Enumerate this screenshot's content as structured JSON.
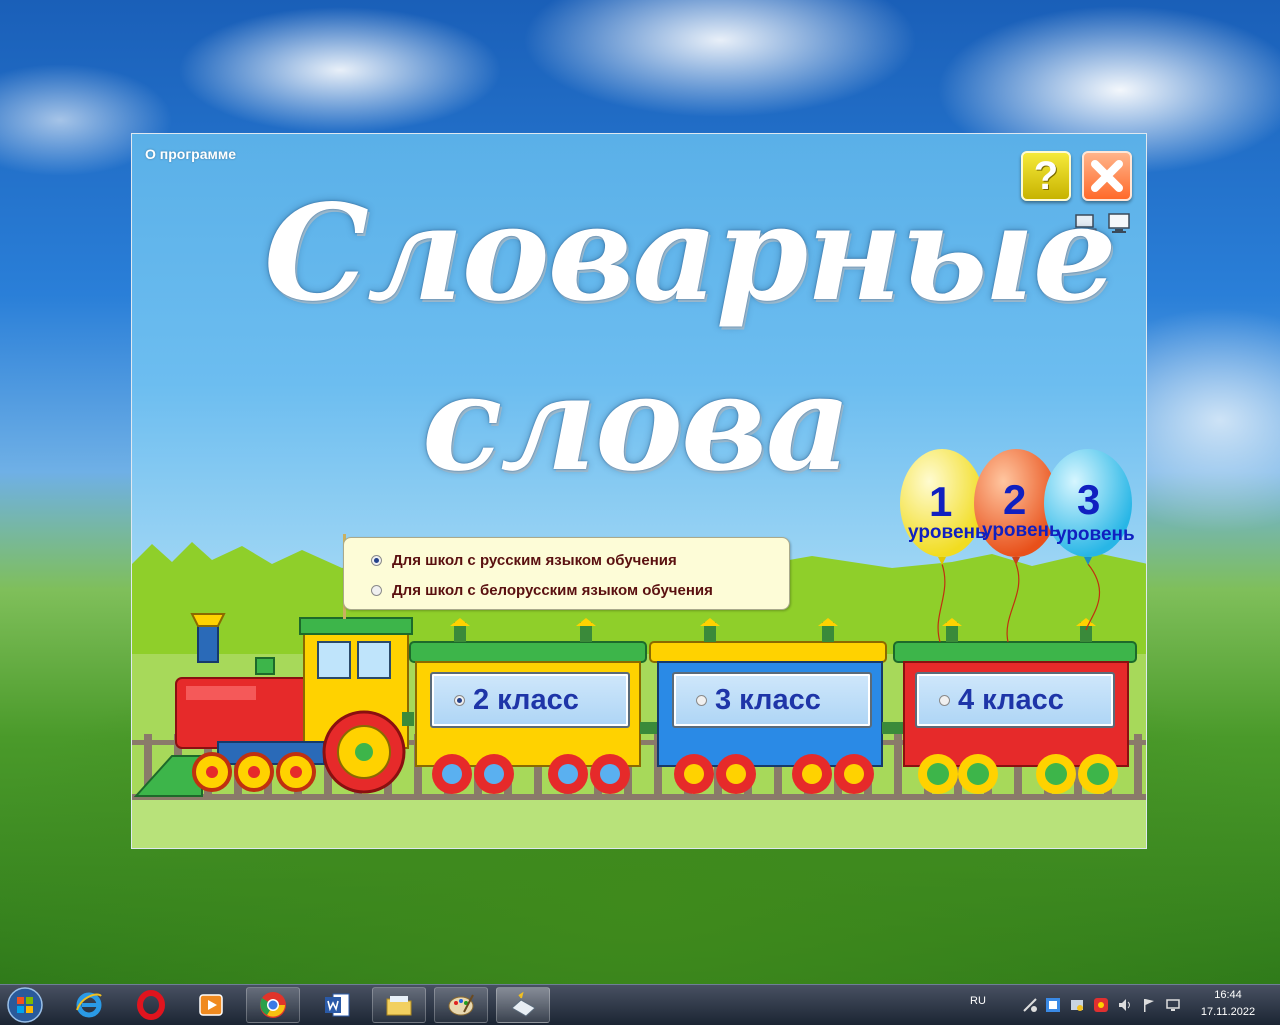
{
  "app": {
    "about_link": "О программе",
    "help_label": "?",
    "title_line1": "Словарные",
    "title_line2": "слова",
    "school_options": [
      {
        "label": "Для школ с русским языком обучения",
        "selected": true
      },
      {
        "label": "Для школ с белорусским языком обучения",
        "selected": false
      }
    ],
    "classes": [
      {
        "label": "2 класс",
        "selected": true
      },
      {
        "label": "3 класс",
        "selected": false
      },
      {
        "label": "4 класс",
        "selected": false
      }
    ],
    "levels": [
      {
        "number": "1",
        "word": "уровень",
        "color": "#f7e94a"
      },
      {
        "number": "2",
        "word": "уровень",
        "color": "#f26a2a"
      },
      {
        "number": "3",
        "word": "уровень",
        "color": "#4ad0f2"
      }
    ]
  },
  "taskbar": {
    "apps": [
      "internet-explorer",
      "opera",
      "media-player",
      "chrome",
      "word",
      "file-explorer",
      "paint",
      "dictionary-app"
    ],
    "language": "RU",
    "time": "16:44",
    "date": "17.11.2022"
  }
}
